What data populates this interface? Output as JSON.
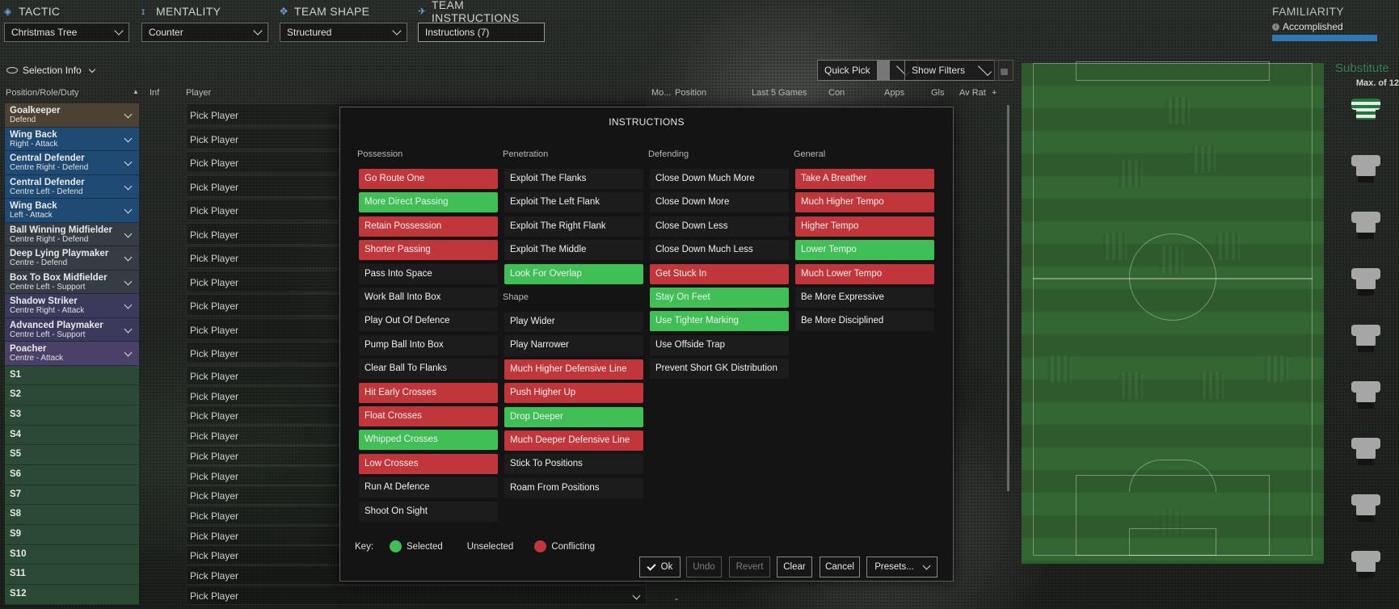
{
  "topbar": {
    "tactic": {
      "label": "TACTIC",
      "value": "Christmas Tree"
    },
    "mentality": {
      "label": "MENTALITY",
      "value": "Counter"
    },
    "team_shape": {
      "label": "TEAM SHAPE",
      "value": "Structured"
    },
    "team_instructions": {
      "label": "TEAM INSTRUCTIONS",
      "value": "Instructions (7)"
    },
    "familiarity": {
      "label": "FAMILIARITY",
      "value": "Accomplished"
    }
  },
  "selection_info": "Selection Info",
  "quick_pick": "Quick Pick",
  "show_filters": "Show Filters",
  "columns": {
    "position_role_duty": "Position/Role/Duty",
    "inf": "Inf",
    "player": "Player",
    "mo": "Mo...",
    "position": "Position",
    "last5": "Last 5 Games",
    "con": "Con",
    "apps": "Apps",
    "gls": "Gls",
    "avrat": "Av Rat"
  },
  "positions": [
    {
      "name": "Goalkeeper",
      "role": "Defend",
      "group": "gk"
    },
    {
      "name": "Wing Back",
      "role": "Right - Attack",
      "group": "def"
    },
    {
      "name": "Central Defender",
      "role": "Centre Right - Defend",
      "group": "def"
    },
    {
      "name": "Central Defender",
      "role": "Centre Left - Defend",
      "group": "def"
    },
    {
      "name": "Wing Back",
      "role": "Left - Attack",
      "group": "def"
    },
    {
      "name": "Ball Winning Midfielder",
      "role": "Centre Right - Defend",
      "group": "mid"
    },
    {
      "name": "Deep Lying Playmaker",
      "role": "Centre - Defend",
      "group": "mid"
    },
    {
      "name": "Box To Box Midfielder",
      "role": "Centre Left - Support",
      "group": "mid"
    },
    {
      "name": "Shadow Striker",
      "role": "Centre Right - Attack",
      "group": "att"
    },
    {
      "name": "Advanced Playmaker",
      "role": "Centre Left - Support",
      "group": "att"
    },
    {
      "name": "Poacher",
      "role": "Centre - Attack",
      "group": "amp"
    }
  ],
  "subs_slots": [
    "S1",
    "S2",
    "S3",
    "S4",
    "S5",
    "S6",
    "S7",
    "S8",
    "S9",
    "S10",
    "S11",
    "S12"
  ],
  "pick_player": "Pick Player",
  "dash": "-",
  "substitutes": {
    "title": "Substitute",
    "max": "Max. of 12"
  },
  "modal": {
    "title": "INSTRUCTIONS",
    "sections": {
      "possession": "Possession",
      "penetration": "Penetration",
      "shape": "Shape",
      "defending": "Defending",
      "general": "General"
    },
    "possession": [
      {
        "label": "Go Route One",
        "state": "conf"
      },
      {
        "label": "More Direct Passing",
        "state": "sel"
      },
      {
        "label": "Retain Possession",
        "state": "conf"
      },
      {
        "label": "Shorter Passing",
        "state": "conf"
      },
      {
        "label": "Pass Into Space",
        "state": "none"
      },
      {
        "label": "Work Ball Into Box",
        "state": "none"
      },
      {
        "label": "Play Out Of Defence",
        "state": "none"
      },
      {
        "label": "Pump Ball Into Box",
        "state": "none"
      },
      {
        "label": "Clear Ball To Flanks",
        "state": "none"
      },
      {
        "label": "Hit Early Crosses",
        "state": "conf"
      },
      {
        "label": "Float Crosses",
        "state": "conf"
      },
      {
        "label": "Whipped Crosses",
        "state": "sel"
      },
      {
        "label": "Low Crosses",
        "state": "conf"
      },
      {
        "label": "Run At Defence",
        "state": "none"
      },
      {
        "label": "Shoot On Sight",
        "state": "none"
      }
    ],
    "penetration": [
      {
        "label": "Exploit The Flanks",
        "state": "none"
      },
      {
        "label": "Exploit The Left Flank",
        "state": "none"
      },
      {
        "label": "Exploit The Right Flank",
        "state": "none"
      },
      {
        "label": "Exploit The Middle",
        "state": "none"
      },
      {
        "label": "Look For Overlap",
        "state": "sel"
      }
    ],
    "shape": [
      {
        "label": "Play Wider",
        "state": "none"
      },
      {
        "label": "Play Narrower",
        "state": "none"
      },
      {
        "label": "Much Higher Defensive Line",
        "state": "conf"
      },
      {
        "label": "Push Higher Up",
        "state": "conf"
      },
      {
        "label": "Drop Deeper",
        "state": "sel"
      },
      {
        "label": "Much Deeper Defensive Line",
        "state": "conf"
      },
      {
        "label": "Stick To Positions",
        "state": "none"
      },
      {
        "label": "Roam From Positions",
        "state": "none"
      }
    ],
    "defending": [
      {
        "label": "Close Down Much More",
        "state": "none"
      },
      {
        "label": "Close Down More",
        "state": "none"
      },
      {
        "label": "Close Down Less",
        "state": "none"
      },
      {
        "label": "Close Down Much Less",
        "state": "none"
      },
      {
        "label": "Get Stuck In",
        "state": "conf"
      },
      {
        "label": "Stay On Feet",
        "state": "sel"
      },
      {
        "label": "Use Tighter Marking",
        "state": "sel"
      },
      {
        "label": "Use Offside Trap",
        "state": "none"
      },
      {
        "label": "Prevent Short GK Distribution",
        "state": "none"
      }
    ],
    "general": [
      {
        "label": "Take A Breather",
        "state": "conf"
      },
      {
        "label": "Much Higher Tempo",
        "state": "conf"
      },
      {
        "label": "Higher Tempo",
        "state": "conf"
      },
      {
        "label": "Lower Tempo",
        "state": "sel"
      },
      {
        "label": "Much Lower Tempo",
        "state": "conf"
      },
      {
        "label": "Be More Expressive",
        "state": "none"
      },
      {
        "label": "Be More Disciplined",
        "state": "none"
      }
    ],
    "key": {
      "title": "Key:",
      "selected": "Selected",
      "unselected": "Unselected",
      "conflicting": "Conflicting"
    },
    "buttons": {
      "ok": "Ok",
      "undo": "Undo",
      "revert": "Revert",
      "clear": "Clear",
      "cancel": "Cancel",
      "presets": "Presets..."
    }
  },
  "colors": {
    "selected": "#3fbf55",
    "conflicting": "#c1363a",
    "accent": "#2d79b8"
  }
}
